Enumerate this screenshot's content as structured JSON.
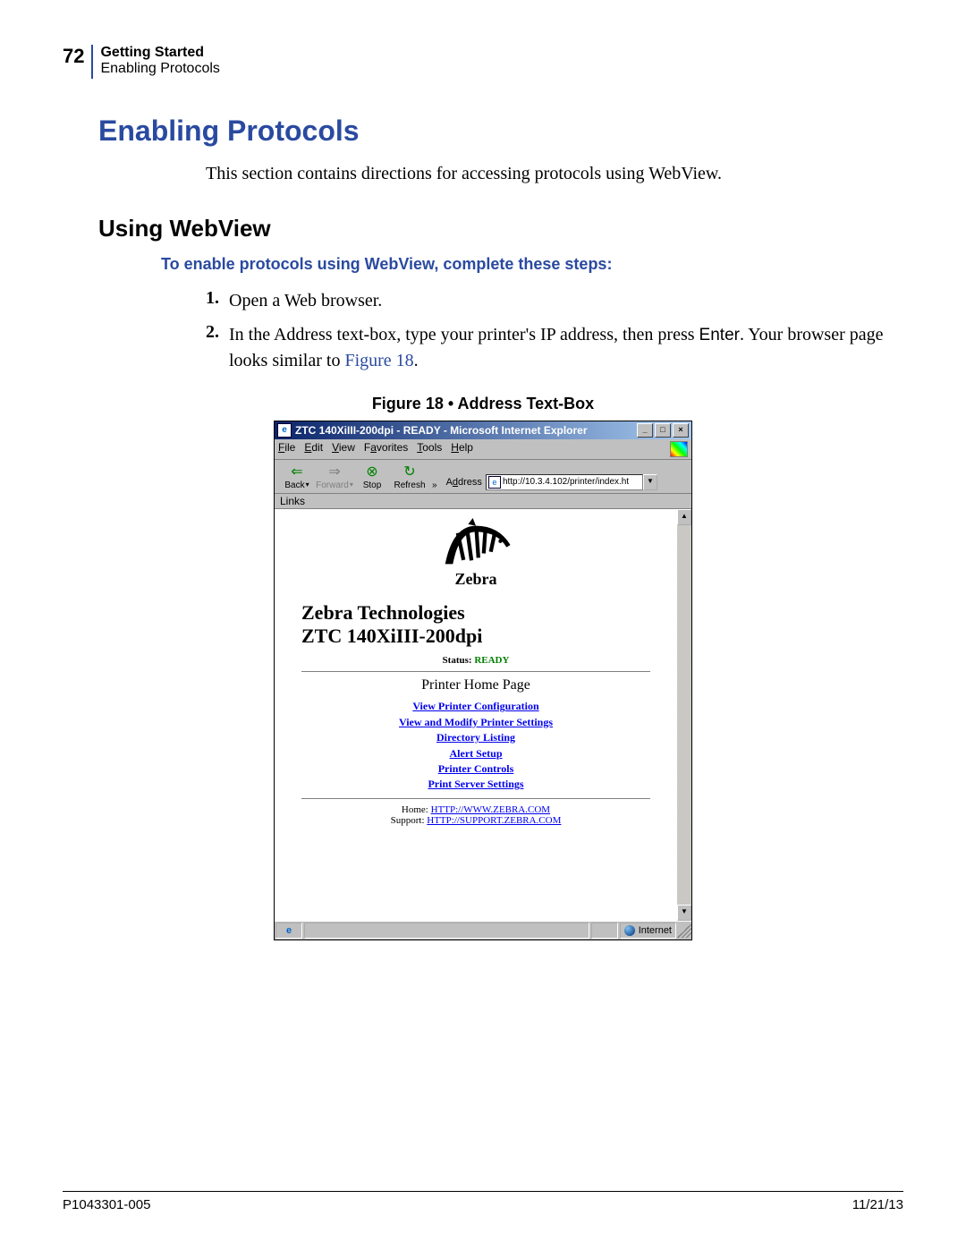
{
  "header": {
    "page_number": "72",
    "chapter": "Getting Started",
    "section": "Enabling Protocols"
  },
  "h1": "Enabling Protocols",
  "intro": "This section contains directions for accessing protocols using WebView.",
  "h2": "Using WebView",
  "h3": "To enable protocols using WebView, complete these steps:",
  "steps": {
    "s1_num": "1.",
    "s1_text": "Open a Web browser.",
    "s2_num": "2.",
    "s2_a": "In the Address text-box, type your printer's IP address, then press ",
    "s2_enter": "Enter",
    "s2_b": ". Your browser page looks similar to ",
    "s2_figref": "Figure 18",
    "s2_c": "."
  },
  "figure": {
    "caption": "Figure 18 • Address Text-Box"
  },
  "ie": {
    "title": "ZTC 140XiIII-200dpi - READY - Microsoft Internet Explorer",
    "win_min": "_",
    "win_max": "□",
    "win_close": "×",
    "menu": {
      "file": "File",
      "edit": "Edit",
      "view": "View",
      "favorites": "Favorites",
      "tools": "Tools",
      "help": "Help"
    },
    "tb": {
      "back": "Back",
      "forward": "Forward",
      "stop": "Stop",
      "refresh": "Refresh",
      "back_icon": "⇐",
      "forward_icon": "⇒",
      "stop_icon": "⊗",
      "refresh_icon": "↻",
      "more": "»"
    },
    "address_label": "Address",
    "address_value": "http://10.3.4.102/printer/index.ht",
    "links_label": "Links",
    "page": {
      "brand": "Zebra",
      "company": "Zebra Technologies",
      "model": "ZTC 140XiIII-200dpi",
      "status_label": "Status: ",
      "status_value": "READY",
      "home_title": "Printer Home Page",
      "links": [
        "View Printer Configuration",
        "View and Modify Printer Settings",
        "Directory Listing",
        "Alert Setup",
        "Printer Controls",
        "Print Server Settings"
      ],
      "home_lbl": "Home: ",
      "home_url": "HTTP://WWW.ZEBRA.COM",
      "support_lbl": "Support: ",
      "support_url": "HTTP://SUPPORT.ZEBRA.COM"
    },
    "status_internet": "Internet",
    "scroll_up": "▲",
    "scroll_down": "▼",
    "addr_dd": "▼"
  },
  "footer": {
    "left": "P1043301-005",
    "right": "11/21/13"
  }
}
